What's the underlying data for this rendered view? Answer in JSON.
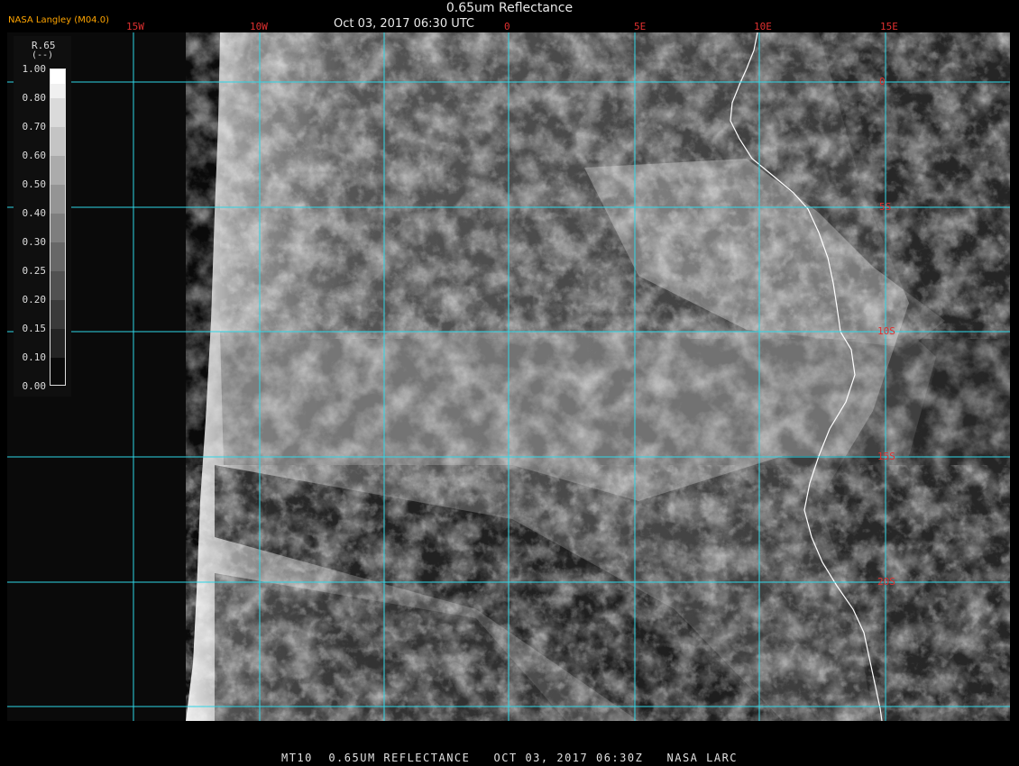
{
  "header": {
    "title": "0.65um Reflectance",
    "subtitle": "Oct 03, 2017 06:30 UTC",
    "agency": "NASA Langley (M04.0)"
  },
  "footer": {
    "text": "MT10  0.65UM REFLECTANCE   OCT 03, 2017 06:30Z   NASA LARC"
  },
  "legend": {
    "title": "R.65",
    "units": "(--)",
    "ticks": [
      "1.00",
      "0.80",
      "0.70",
      "0.60",
      "0.50",
      "0.40",
      "0.30",
      "0.25",
      "0.20",
      "0.15",
      "0.10",
      "0.00"
    ]
  },
  "grid": {
    "longitudes": [
      "15W",
      "10W",
      "0",
      "5E",
      "10E",
      "15E"
    ],
    "latitudes": [
      "0",
      "5S",
      "10S",
      "15S",
      "20S"
    ]
  },
  "colors": {
    "grid": "#2fd6e6",
    "labels": "#e03030",
    "coast": "#ffffff"
  }
}
